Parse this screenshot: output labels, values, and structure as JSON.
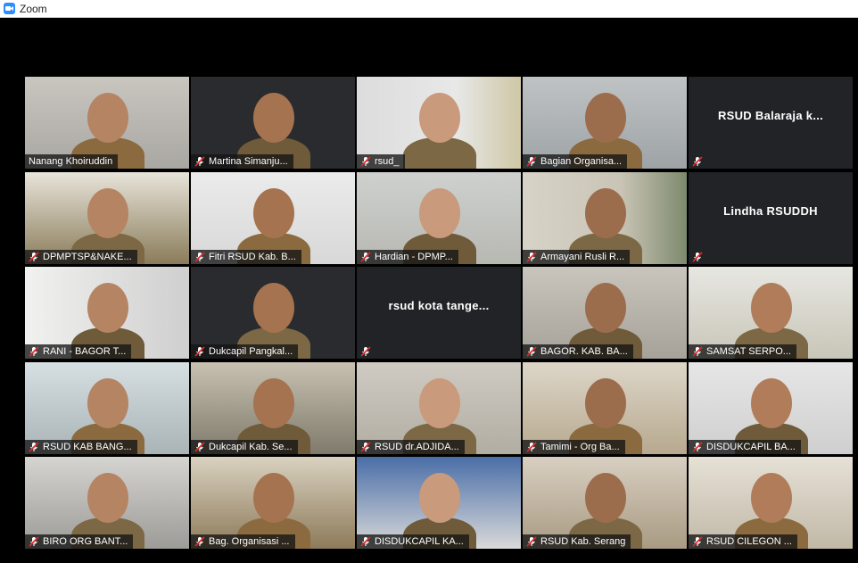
{
  "window": {
    "title": "Zoom",
    "app_icon": "zoom-logo-icon"
  },
  "gallery": {
    "participants": [
      {
        "name": "Nanang Khoiruddin",
        "muted": false,
        "active_speaker": true,
        "video": true
      },
      {
        "name": "Martina Simanju...",
        "muted": true,
        "video": true
      },
      {
        "name": "rsud_",
        "muted": true,
        "video": true
      },
      {
        "name": "Bagian Organisa...",
        "muted": true,
        "video": true
      },
      {
        "name": "RSUD Balaraja k...",
        "muted": true,
        "video": false
      },
      {
        "name": "DPMPTSP&NAKE...",
        "muted": true,
        "video": true
      },
      {
        "name": "Fitri RSUD Kab. B...",
        "muted": true,
        "video": true
      },
      {
        "name": "Hardian - DPMP...",
        "muted": true,
        "video": true
      },
      {
        "name": "Armayani Rusli R...",
        "muted": true,
        "video": true
      },
      {
        "name": "Lindha RSUDDH",
        "muted": true,
        "video": false
      },
      {
        "name": "RANI - BAGOR T...",
        "muted": true,
        "video": true
      },
      {
        "name": "Dukcapil Pangkal...",
        "muted": true,
        "video": true
      },
      {
        "name": "rsud kota tange...",
        "muted": true,
        "video": false
      },
      {
        "name": "BAGOR. KAB. BA...",
        "muted": true,
        "video": true
      },
      {
        "name": "SAMSAT SERPO...",
        "muted": true,
        "video": true
      },
      {
        "name": "RSUD KAB BANG...",
        "muted": true,
        "video": true
      },
      {
        "name": "Dukcapil Kab. Se...",
        "muted": true,
        "video": true
      },
      {
        "name": "RSUD dr.ADJIDA...",
        "muted": true,
        "video": true
      },
      {
        "name": "Tamimi - Org Ba...",
        "muted": true,
        "video": true
      },
      {
        "name": "DISDUKCAPIL BA...",
        "muted": true,
        "video": true
      },
      {
        "name": "BIRO ORG  BANT...",
        "muted": true,
        "video": true
      },
      {
        "name": "Bag. Organisasi ...",
        "muted": true,
        "video": true
      },
      {
        "name": "DISDUKCAPIL KA...",
        "muted": true,
        "video": true
      },
      {
        "name": "RSUD Kab. Serang",
        "muted": true,
        "video": true
      },
      {
        "name": "RSUD CILEGON ...",
        "muted": true,
        "video": true
      }
    ]
  },
  "colors": {
    "mute_red": "#e02828",
    "active_border": "#d6ea6a",
    "zoom_blue": "#2d8cff"
  }
}
